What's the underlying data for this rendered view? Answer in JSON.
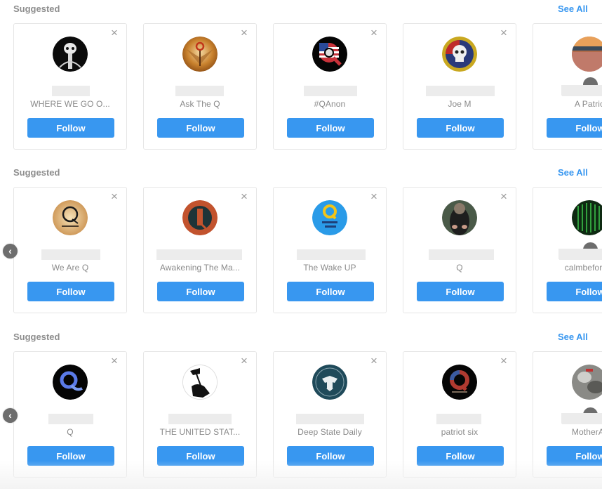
{
  "colors": {
    "accent": "#3897f0",
    "label": "#8e8e8e",
    "border": "#e6e6e6",
    "placeholder": "#ececec"
  },
  "sections": [
    {
      "label": "Suggested",
      "see_all": "See All",
      "has_prev_arrow": false,
      "cards": [
        {
          "name": "WHERE WE GO O...",
          "follow_label": "Follow",
          "close_icon": "×",
          "avatar": "skull-black"
        },
        {
          "name": "Ask The Q",
          "follow_label": "Follow",
          "close_icon": "×",
          "avatar": "golden-q"
        },
        {
          "name": "#QAnon",
          "follow_label": "Follow",
          "close_icon": "×",
          "avatar": "flag-q"
        },
        {
          "name": "Joe M",
          "follow_label": "Follow",
          "close_icon": "×",
          "avatar": "skull-badge"
        },
        {
          "name": "A Patric",
          "follow_label": "Follow",
          "close_icon": "×",
          "avatar": "crowd-photo"
        }
      ]
    },
    {
      "label": "Suggested",
      "see_all": "See All",
      "has_prev_arrow": true,
      "prev_arrow_icon": "‹",
      "cards": [
        {
          "name": "We Are Q",
          "follow_label": "Follow",
          "close_icon": "×",
          "avatar": "parchment-q"
        },
        {
          "name": "Awakening The Ma...",
          "follow_label": "Follow",
          "close_icon": "×",
          "avatar": "orange-q"
        },
        {
          "name": "The Wake UP",
          "follow_label": "Follow",
          "close_icon": "×",
          "avatar": "blue-wake-q"
        },
        {
          "name": "Q",
          "follow_label": "Follow",
          "close_icon": "×",
          "avatar": "person-photo"
        },
        {
          "name": "calmbeforeth",
          "follow_label": "Follow",
          "close_icon": "×",
          "avatar": "matrix-green"
        }
      ]
    },
    {
      "label": "Suggested",
      "see_all": "See All",
      "has_prev_arrow": true,
      "prev_arrow_icon": "‹",
      "cards": [
        {
          "name": "Q",
          "follow_label": "Follow",
          "close_icon": "×",
          "avatar": "neon-q"
        },
        {
          "name": "THE UNITED STAT...",
          "follow_label": "Follow",
          "close_icon": "×",
          "avatar": "flag-raising"
        },
        {
          "name": "Deep State Daily",
          "follow_label": "Follow",
          "close_icon": "×",
          "avatar": "eagle-seal"
        },
        {
          "name": "patriot six",
          "follow_label": "Follow",
          "close_icon": "×",
          "avatar": "dark-flag-q"
        },
        {
          "name": "MotherAr",
          "follow_label": "Follow",
          "close_icon": "×",
          "avatar": "gray-photo"
        }
      ]
    }
  ]
}
